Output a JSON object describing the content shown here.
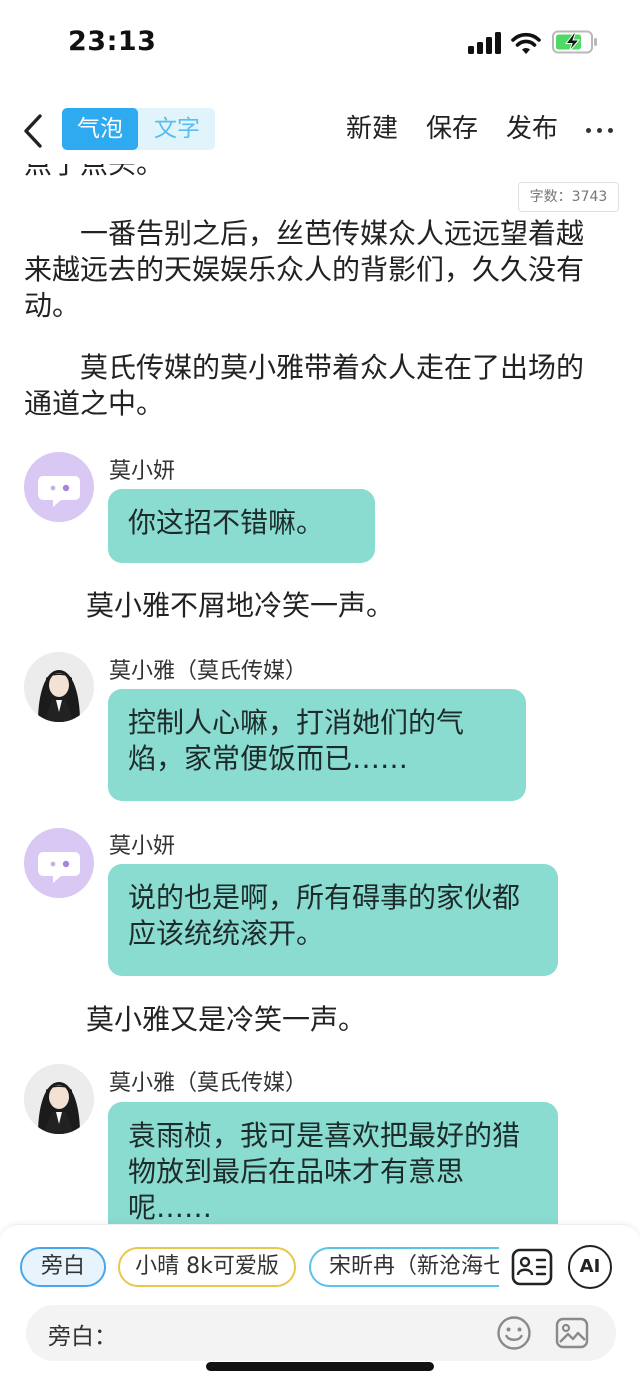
{
  "status_bar": {
    "time": "23:13"
  },
  "nav": {
    "back_icon": "chevron-left-icon",
    "mode_tabs": [
      "气泡",
      "文字"
    ],
    "actions": {
      "new": "新建",
      "save": "保存",
      "publish": "发布"
    },
    "more_icon": "more-dots-icon"
  },
  "story": {
    "word_count": "字数：3743",
    "top_fragment": "点了点头。",
    "para1": "一番告别之后，丝芭传媒众人远远望着越来越远去的天娱娱乐众人的背影们，久久没有动。",
    "para2": "莫氏传媒的莫小雅带着众人走在了出场的通道之中。",
    "messages": [
      {
        "speaker": "莫小妍",
        "text": "你这招不错嘛。"
      },
      {
        "narration": "莫小雅不屑地冷笑一声。"
      },
      {
        "speaker": "莫小雅（莫氏传媒）",
        "text": "控制人心嘛，打消她们的气焰，家常便饭而已……"
      },
      {
        "speaker": "莫小妍",
        "text": "说的也是啊，所有碍事的家伙都应该统统滚开。"
      },
      {
        "narration": "莫小雅又是冷笑一声。"
      },
      {
        "speaker": "莫小雅（莫氏传媒）",
        "text": "袁雨桢，我可是喜欢把最好的猎物放到最后在品味才有意思呢……"
      }
    ]
  },
  "bottom": {
    "chips": [
      "旁白",
      "小晴 8k可爱版",
      "宋昕冉（新沧海七"
    ],
    "role_card_icon": "role-card-icon",
    "ai_label": "AI",
    "input_label": "旁白：",
    "input_placeholder": "",
    "emoji_icon": "emoji-icon",
    "image_icon": "image-icon"
  },
  "colors": {
    "accent_blue": "#2eaaf0",
    "bubble_teal": "#8adbd0",
    "placeholder_avatar": "#d9c8f3"
  }
}
